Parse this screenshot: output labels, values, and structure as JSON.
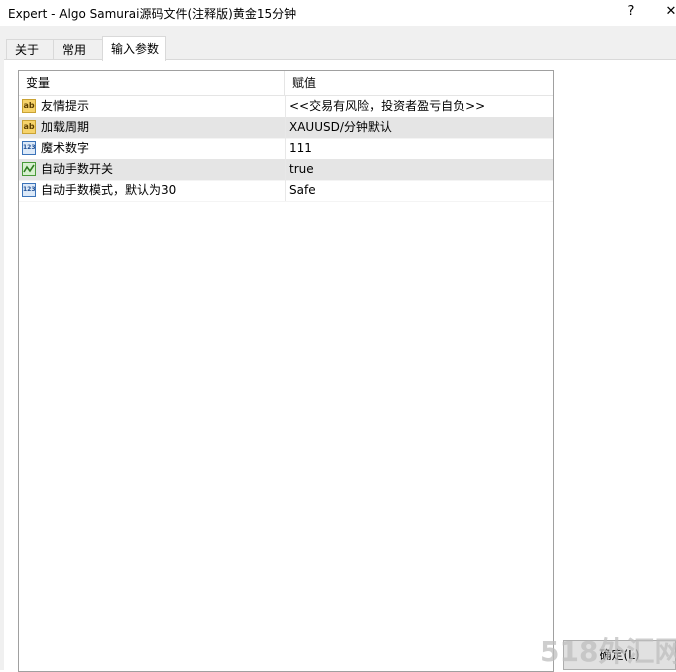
{
  "window": {
    "title": "Expert - Algo Samurai源码文件(注释版)黄金15分钟",
    "help_label": "?",
    "close_label": "✕"
  },
  "tabs": [
    {
      "label": "关于"
    },
    {
      "label": "常用"
    },
    {
      "label": "输入参数",
      "active": true
    }
  ],
  "grid": {
    "columns": [
      "变量",
      "赋值"
    ],
    "rows": [
      {
        "icon": "text-param-icon",
        "name": "友情提示",
        "value": "<<交易有风险，投资者盈亏自负>>"
      },
      {
        "icon": "text-param-icon",
        "name": "加载周期",
        "value": "XAUUSD/分钟默认"
      },
      {
        "icon": "integer-param-icon",
        "name": "魔术数字",
        "value": "111"
      },
      {
        "icon": "bool-param-icon",
        "name": "自动手数开关",
        "value": "true"
      },
      {
        "icon": "integer-param-icon",
        "name": "自动手数模式，默认为30",
        "value": "Safe"
      }
    ]
  },
  "footer": {
    "ok_label": "确定(L)"
  },
  "watermark": "518外汇网"
}
